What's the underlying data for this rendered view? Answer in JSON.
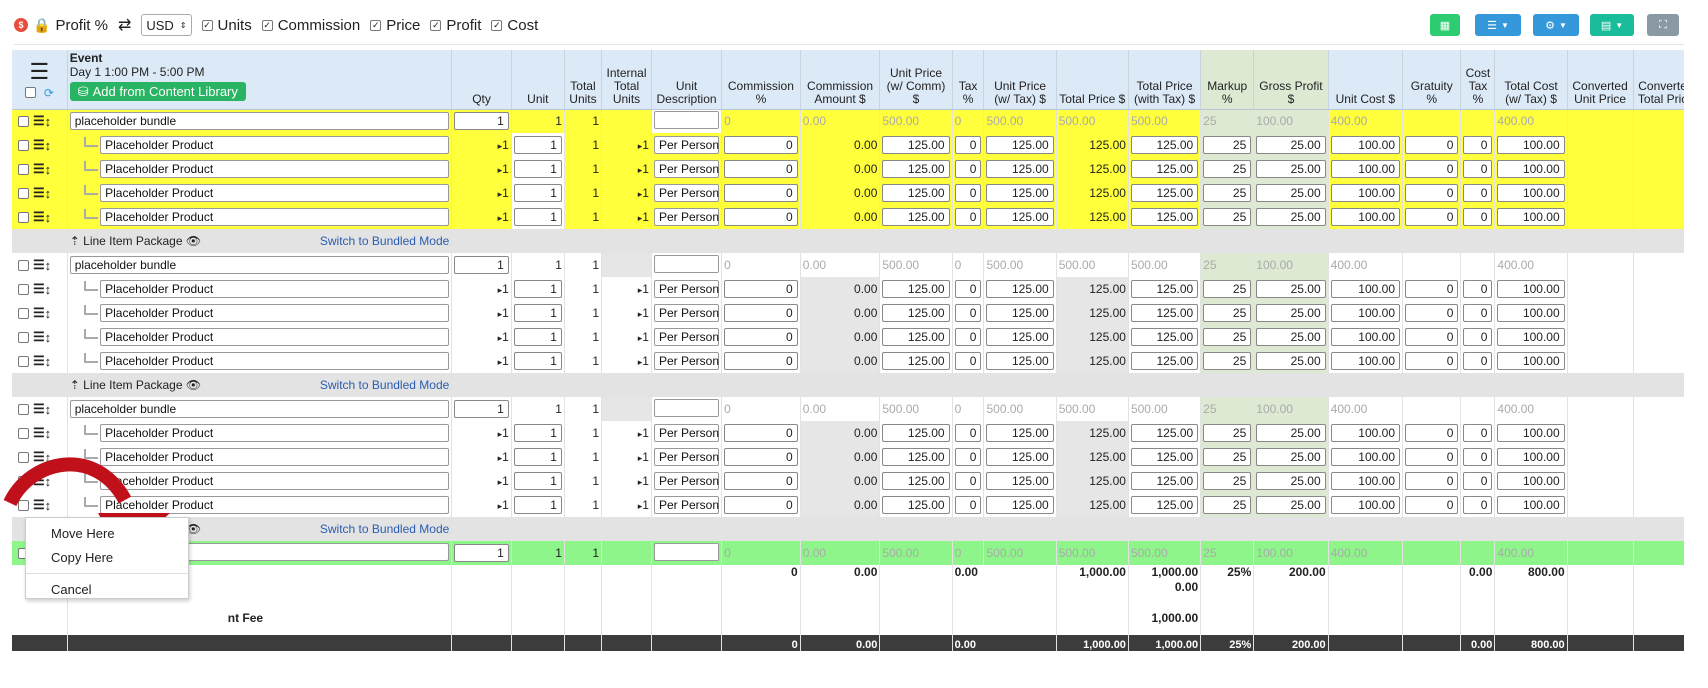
{
  "toolbar": {
    "profit_label": "Profit %",
    "currency": "USD",
    "toggles": [
      "Units",
      "Commission",
      "Price",
      "Profit",
      "Cost"
    ],
    "colors": {
      "green": "#2ecc71",
      "blue": "#3498db",
      "teal": "#1abc9c",
      "gray": "#8a9aa5"
    }
  },
  "headers": {
    "event": "Event",
    "event_date": "Day 1 1:00 PM - 5:00 PM",
    "add_library": "Add from Content Library",
    "qty": "Qty",
    "unit": "Unit",
    "total_units": "Total Units",
    "internal_total_units": "Internal Total Units",
    "unit_description": "Unit Description",
    "commission_pct": "Commission %",
    "commission_amount": "Commission Amount $",
    "unit_price_comm": "Unit Price (w/ Comm) $",
    "tax_pct": "Tax %",
    "unit_price_tax": "Unit Price (w/ Tax) $",
    "total_price": "Total Price $",
    "total_price_tax": "Total Price (with Tax) $",
    "markup": "Markup %",
    "gross_profit": "Gross Profit $",
    "unit_cost": "Unit Cost $",
    "gratuity": "Gratuity %",
    "cost_tax": "Cost Tax %",
    "total_cost_tax": "Total Cost (w/ Tax) $",
    "converted_unit_price": "Converted Unit Price",
    "converted_total_price": "Converted Total Price",
    "co": "Co"
  },
  "bundle": {
    "name": "placeholder bundle",
    "qty": "1",
    "unit": "1",
    "total_units": "1",
    "comm_pct": "0",
    "comm_amt": "0.00",
    "unit_price_comm": "500.00",
    "tax": "0",
    "unit_price_tax": "500.00",
    "total_price": "500.00",
    "total_price_tax": "500.00",
    "markup": "25",
    "gross_profit": "100.00",
    "unit_cost": "400.00",
    "total_cost": "400.00"
  },
  "product": {
    "name": "Placeholder Product",
    "qty": "1",
    "unit": "1",
    "total_units": "1",
    "internal_units": "1",
    "unit_desc": "Per Person",
    "comm_pct": "0",
    "comm_amt": "0.00",
    "unit_price_comm": "125.00",
    "tax": "0",
    "unit_price_tax": "125.00",
    "total_price": "125.00",
    "total_price_tax": "125.00",
    "markup": "25",
    "gross_profit": "25.00",
    "unit_cost": "100.00",
    "gratuity": "0",
    "cost_tax": "0",
    "total_cost": "100.00"
  },
  "package": {
    "label": "Line Item Package",
    "switch": "Switch to Bundled Mode"
  },
  "new_row": {
    "qty": "1",
    "unit": "1",
    "total_units": "1",
    "comm_pct": "0",
    "comm_amt": "0.00",
    "unit_price_comm": "500.00",
    "tax": "0",
    "unit_price_tax": "500.00",
    "total_price": "500.00",
    "total_price_tax": "500.00",
    "markup": "25",
    "gross_profit": "100.00",
    "unit_cost": "400.00",
    "total_cost": "400.00"
  },
  "totals": {
    "comm_pct": "0",
    "comm_amt": "0.00",
    "tax": "0.00",
    "total_price": "1,000.00",
    "total_price_tax": "1,000.00",
    "total_price_tax_2": "0.00",
    "total_price_tax_3": "1,000.00",
    "markup": "25%",
    "gross_profit": "200.00",
    "cost_tax": "0.00",
    "total_cost": "800.00",
    "fee_label": "nt Fee"
  },
  "grand": {
    "comm_pct": "0",
    "comm_amt": "0.00",
    "tax": "0.00",
    "total_price": "1,000.00",
    "total_price_tax": "1,000.00",
    "markup": "25%",
    "gross_profit": "200.00",
    "cost_tax": "0.00",
    "total_cost": "800.00"
  },
  "context_menu": {
    "move": "Move Here",
    "copy": "Copy Here",
    "cancel": "Cancel"
  }
}
